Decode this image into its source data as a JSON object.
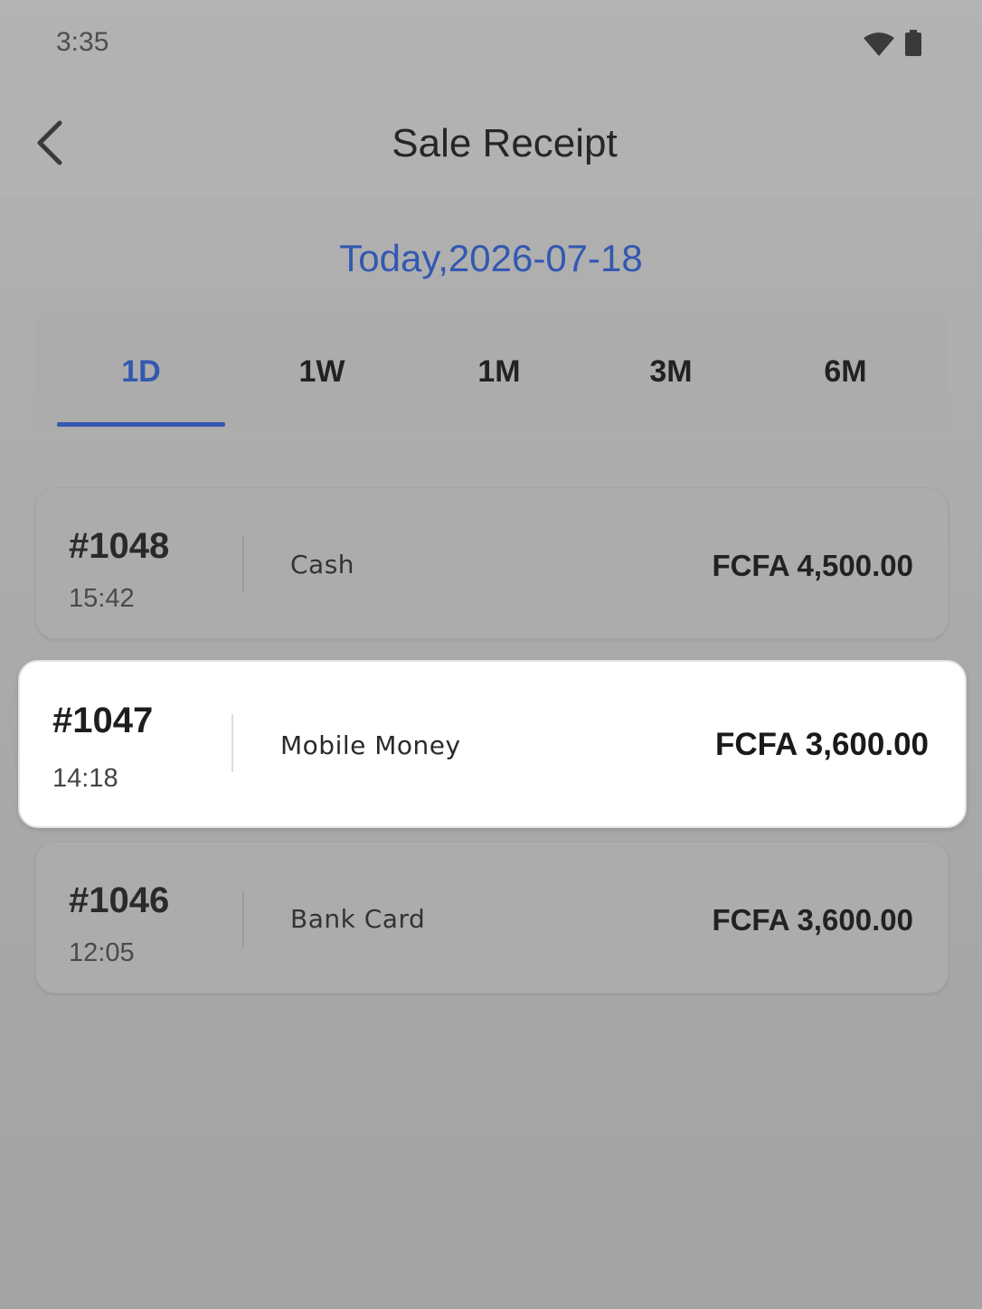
{
  "status_bar": {
    "time": "3:35",
    "wifi_icon": "wifi-icon",
    "battery_icon": "battery-icon"
  },
  "header": {
    "title": "Sale Receipt",
    "back_icon": "chevron-left-icon"
  },
  "date_label": "Today,2026-07-18",
  "tabs": [
    {
      "label": "1D",
      "active": true
    },
    {
      "label": "1W",
      "active": false
    },
    {
      "label": "1M",
      "active": false
    },
    {
      "label": "3M",
      "active": false
    },
    {
      "label": "6M",
      "active": false
    }
  ],
  "receipts": [
    {
      "number": "#1048",
      "time": "15:42",
      "method": "Cash",
      "amount": "FCFA 4,500.00",
      "highlighted": false
    },
    {
      "number": "#1047",
      "time": "14:18",
      "method": "Mobile Money",
      "amount": "FCFA 3,600.00",
      "highlighted": true
    },
    {
      "number": "#1046",
      "time": "12:05",
      "method": "Bank Card",
      "amount": "FCFA 3,600.00",
      "highlighted": false
    }
  ],
  "colors": {
    "accent": "#3358b0",
    "background": "#b0b0b0",
    "card_highlight": "#ffffff"
  }
}
